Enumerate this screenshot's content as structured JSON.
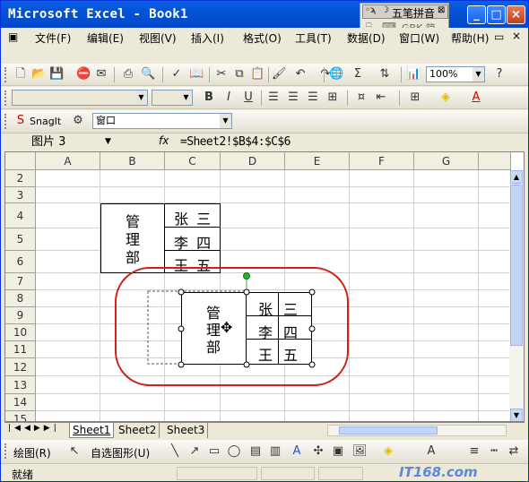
{
  "window": {
    "title": "Microsoft Excel - Book1"
  },
  "ime": {
    "name": "五笔拼音",
    "status": "GBK 简"
  },
  "menu": [
    "文件(F)",
    "编辑(E)",
    "视图(V)",
    "插入(I)",
    "格式(O)",
    "工具(T)",
    "数据(D)",
    "窗口(W)",
    "帮助(H)"
  ],
  "toolbar": {
    "zoom": "100%"
  },
  "snagit": {
    "label": "SnagIt",
    "combo": "窗口"
  },
  "formula_bar": {
    "name_box": "图片 3",
    "fx": "fx",
    "formula": "=Sheet2!$B$4:$C$6"
  },
  "columns": [
    "A",
    "B",
    "C",
    "D",
    "E",
    "F",
    "G"
  ],
  "rows": [
    "2",
    "3",
    "4",
    "5",
    "6",
    "7",
    "8",
    "9",
    "10",
    "11",
    "12",
    "13",
    "14",
    "15"
  ],
  "source_table": {
    "dept": [
      "管",
      "理",
      "部"
    ],
    "names": [
      "张 三",
      "李 四",
      "王 五"
    ]
  },
  "picture": {
    "dept": [
      "管",
      "理",
      "部"
    ],
    "names": [
      [
        "张",
        "三"
      ],
      [
        "李",
        "四"
      ],
      [
        "王",
        "五"
      ]
    ]
  },
  "sheet_tabs": [
    "Sheet1",
    "Sheet2",
    "Sheet3"
  ],
  "draw_toolbar": {
    "draw": "绘图(R)",
    "autoshapes": "自选图形(U)"
  },
  "status": {
    "text": "就绪"
  },
  "watermark": "IT168.com",
  "colors": {
    "title_bar": "#0553d6",
    "highlight_ellipse": "#d0201a",
    "handle_green": "#27b327"
  }
}
